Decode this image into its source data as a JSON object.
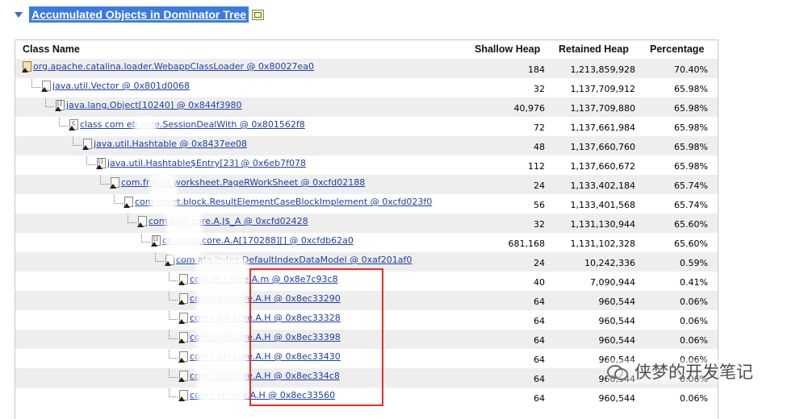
{
  "section": {
    "title": "Accumulated Objects in Dominator Tree"
  },
  "columns": {
    "class_name": "Class Name",
    "shallow_heap": "Shallow Heap",
    "retained_heap": "Retained Heap",
    "percentage": "Percentage"
  },
  "rows": [
    {
      "icon": "loader",
      "name": "org.apache.catalina.loader.WebappClassLoader @ 0x80027ea0",
      "shallow": "184",
      "retained": "1,213,859,928",
      "percent": "70.40%"
    },
    {
      "icon": "object",
      "name": "java.util.Vector @ 0x801d0068",
      "shallow": "32",
      "retained": "1,137,709,912",
      "percent": "65.98%"
    },
    {
      "icon": "array",
      "name": "java.lang.Object[10240] @ 0x844f3980",
      "shallow": "40,976",
      "retained": "1,137,709,880",
      "percent": "65.98%"
    },
    {
      "icon": "class",
      "name": "class com        eb.core.SessionDealWith @ 0x801562f8",
      "shallow": "72",
      "retained": "1,137,661,984",
      "percent": "65.98%"
    },
    {
      "icon": "object",
      "name": "java.util.Hashtable @ 0x8437ee08",
      "shallow": "48",
      "retained": "1,137,660,760",
      "percent": "65.98%"
    },
    {
      "icon": "array",
      "name": "java.util.Hashtable$Entry[23] @ 0x6eb7f078",
      "shallow": "112",
      "retained": "1,137,660,672",
      "percent": "65.98%"
    },
    {
      "icon": "object",
      "name": "com.fr       port.worksheet.PageRWorkSheet @ 0xcfd02188",
      "shallow": "24",
      "retained": "1,133,402,184",
      "percent": "65.74%"
    },
    {
      "icon": "object",
      "name": "com       eport.block.ResultElementCaseBlockImplement @ 0xcfd023f0",
      "shallow": "56",
      "retained": "1,133,401,568",
      "percent": "65.74%"
    },
    {
      "icon": "object",
      "name": "com        port.core.A.J$_A @ 0xcfd02428",
      "shallow": "32",
      "retained": "1,131,130,944",
      "percent": "65.60%"
    },
    {
      "icon": "array",
      "name": "co          eport.core.A.A[170288][] @ 0xcfdb62a0",
      "shallow": "681,168",
      "retained": "1,131,102,328",
      "percent": "65.60%"
    },
    {
      "icon": "object",
      "name": "com         ata.index.DefaultIndexDataModel @ 0xaf201af0",
      "shallow": "24",
      "retained": "10,242,336",
      "percent": "0.59%"
    },
    {
      "icon": "object",
      "name": "com.re      t.core.A.m @ 0x8e7c93c8",
      "shallow": "40",
      "retained": "7,090,944",
      "percent": "0.41%"
    },
    {
      "icon": "object",
      "name": "com.r       ort.core.A.H @ 0x8ec33290",
      "shallow": "64",
      "retained": "960,544",
      "percent": "0.06%"
    },
    {
      "icon": "object",
      "name": "com.r       ort.core.A.H @ 0x8ec33328",
      "shallow": "64",
      "retained": "960,544",
      "percent": "0.06%"
    },
    {
      "icon": "object",
      "name": "com.r       ort.core.A.H @ 0x8ec33398",
      "shallow": "64",
      "retained": "960,544",
      "percent": "0.06%"
    },
    {
      "icon": "object",
      "name": "com.r       ort.core.A.H @ 0x8ec33430",
      "shallow": "64",
      "retained": "960,544",
      "percent": "0.06%"
    },
    {
      "icon": "object",
      "name": "com.r       ort.core.A.H @ 0x8ec334c8",
      "shallow": "64",
      "retained": "960,544",
      "percent": "0.06%"
    },
    {
      "icon": "object",
      "name": "com.r       rt.core.A.H @ 0x8ec33560",
      "shallow": "64",
      "retained": "960,544",
      "percent": "0.06%"
    }
  ],
  "watermark": {
    "text": "侠梦的开发笔记"
  },
  "colors": {
    "highlight": "#3b7be0",
    "link": "#1c3fa8",
    "annotation": "#e3312a"
  }
}
